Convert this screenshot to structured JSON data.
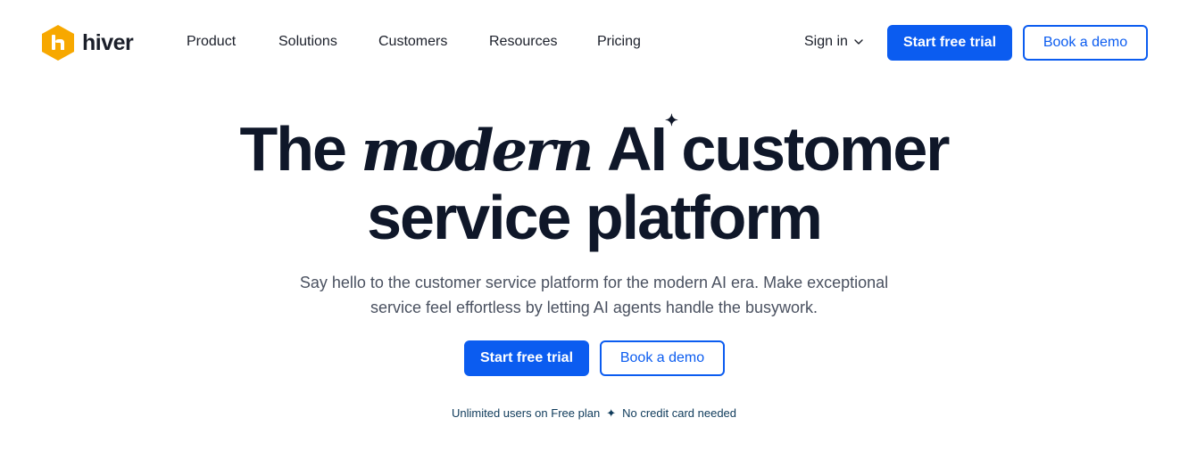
{
  "brand": {
    "name": "hiver",
    "logo_color": "#f7a800",
    "accent": "#0b5cf0",
    "text_dark": "#0f1729"
  },
  "nav": {
    "links": [
      {
        "label": "Product"
      },
      {
        "label": "Solutions"
      },
      {
        "label": "Customers"
      },
      {
        "label": "Resources"
      },
      {
        "label": "Pricing"
      }
    ],
    "sign_in": "Sign in",
    "sign_in_icon": "chevron-down-icon",
    "primary_cta": "Start free trial",
    "secondary_cta": "Book a demo"
  },
  "hero": {
    "title_part1": "The",
    "title_emphasis": "modern",
    "title_ai": "AI",
    "title_sparkle": "✦",
    "title_part2": "customer",
    "title_line2": "service platform",
    "subtitle_line1": "Say hello to the customer service platform for the modern AI era. Make exceptional",
    "subtitle_line2": "service feel effortless by letting AI agents handle the busywork.",
    "primary_cta": "Start free trial",
    "secondary_cta": "Book a demo",
    "note_left": "Unlimited users on Free plan",
    "note_sep": "✦",
    "note_right": "No credit card needed"
  }
}
